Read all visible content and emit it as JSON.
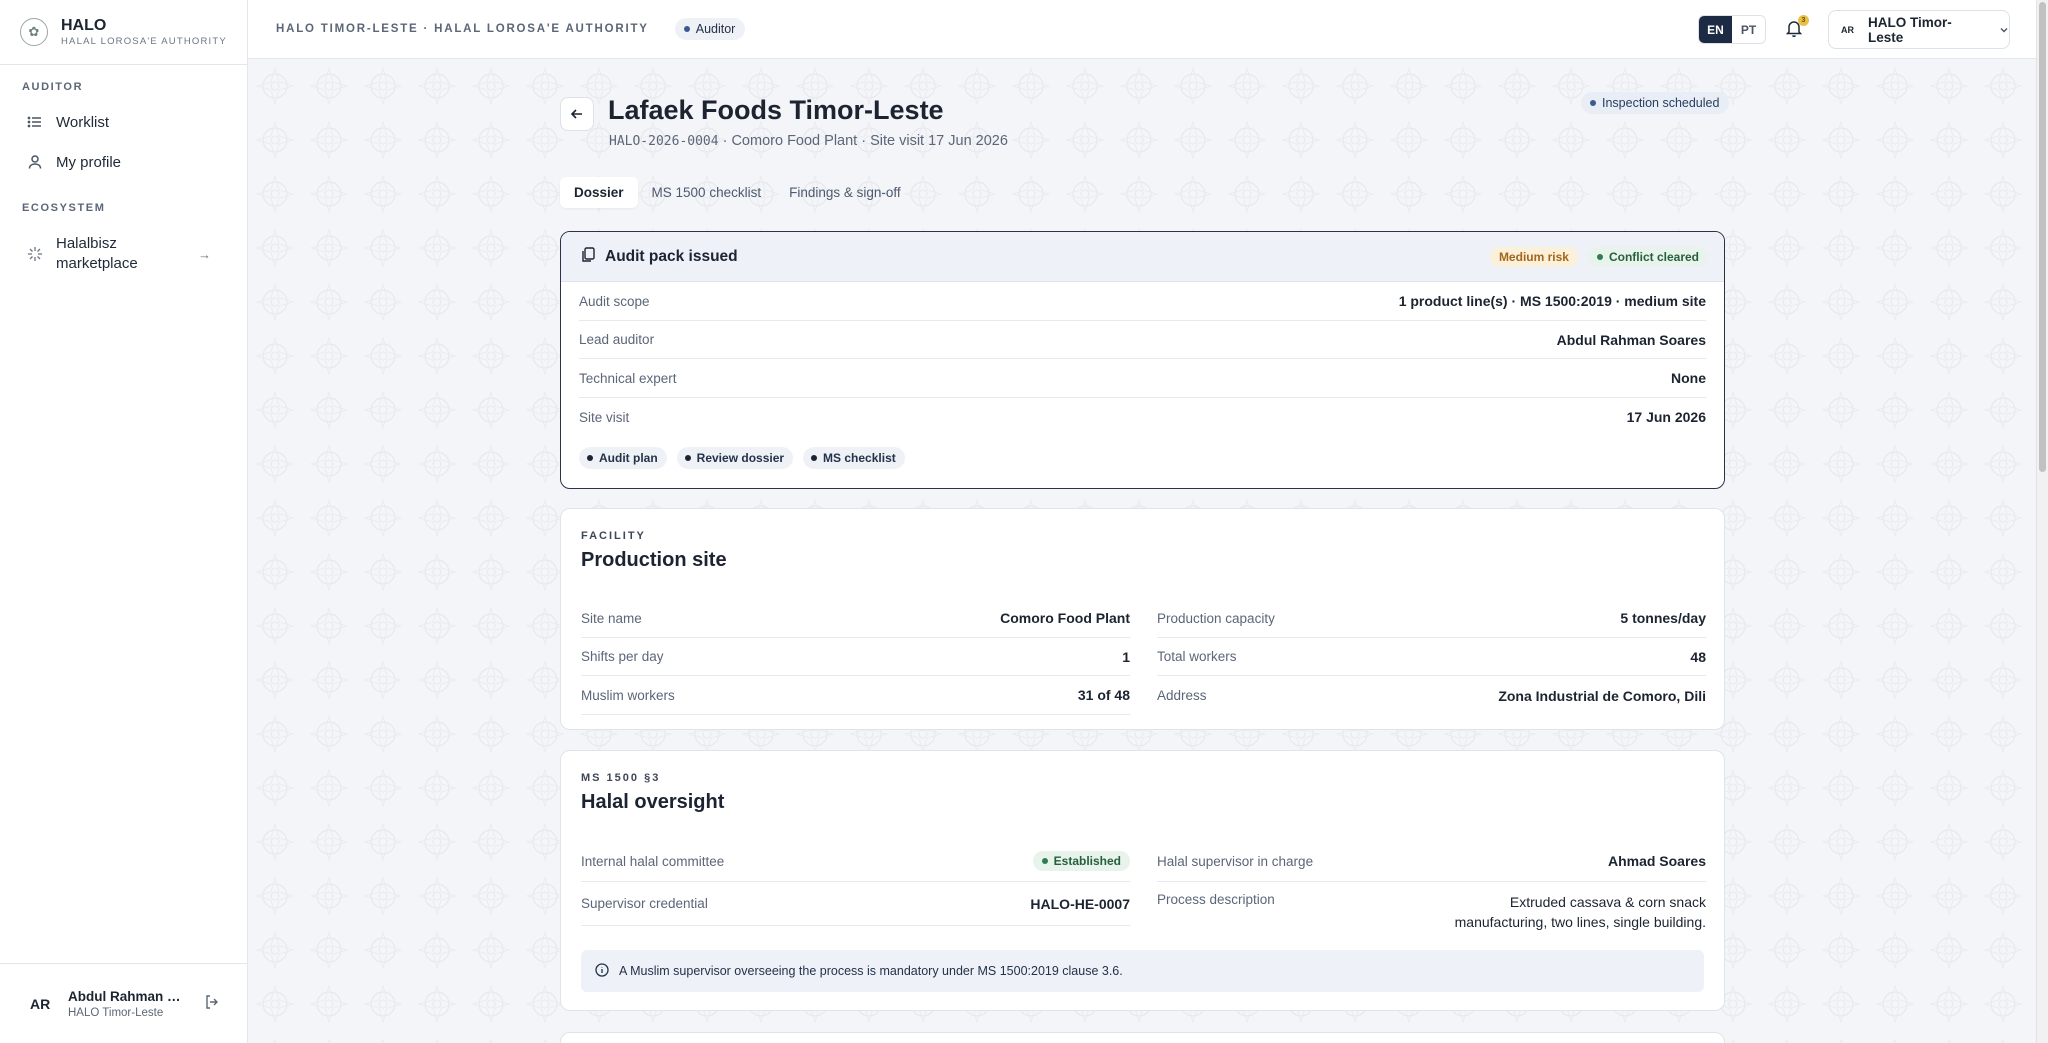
{
  "brand": {
    "title": "HALO",
    "subtitle": "HALAL LOROSA'E AUTHORITY"
  },
  "sidebar": {
    "sections": [
      {
        "label": "AUDITOR",
        "items": [
          {
            "label": "Worklist",
            "icon": "list-icon"
          },
          {
            "label": "My profile",
            "icon": "user-icon"
          }
        ]
      },
      {
        "label": "ECOSYSTEM",
        "items": [
          {
            "label": "Halalbisz marketplace",
            "icon": "sparkle-icon"
          }
        ]
      }
    ],
    "user": {
      "initials": "AR",
      "name": "Abdul Rahman Soares",
      "org": "HALO Timor-Leste"
    }
  },
  "topbar": {
    "org_label": "HALO TIMOR-LESTE · HALAL LOROSA'E AUTHORITY",
    "role": "Auditor",
    "languages": [
      "EN",
      "PT"
    ],
    "active_language": "EN",
    "notification_count": "3",
    "account": {
      "initials": "AR",
      "name": "HALO Timor-Leste"
    }
  },
  "page": {
    "title": "Lafaek Foods Timor-Leste",
    "ref_code": "HALO-2026-0004",
    "meta_rest": " · Comoro Food Plant · Site visit 17 Jun 2026",
    "status": "Inspection scheduled",
    "tabs": [
      "Dossier",
      "MS 1500 checklist",
      "Findings & sign-off"
    ],
    "active_tab": "Dossier"
  },
  "audit_pack": {
    "title": "Audit pack issued",
    "risk_badge": "Medium risk",
    "conflict_badge": "Conflict cleared",
    "rows": [
      {
        "label": "Audit scope",
        "value": "1 product line(s) · MS 1500:2019 · medium site"
      },
      {
        "label": "Lead auditor",
        "value": "Abdul Rahman Soares"
      },
      {
        "label": "Technical expert",
        "value": "None"
      },
      {
        "label": "Site visit",
        "value": "17 Jun 2026"
      }
    ],
    "actions": [
      "Audit plan",
      "Review dossier",
      "MS checklist"
    ]
  },
  "facility": {
    "kicker": "FACILITY",
    "title": "Production site",
    "left": [
      {
        "label": "Site name",
        "value": "Comoro Food Plant"
      },
      {
        "label": "Shifts per day",
        "value": "1"
      },
      {
        "label": "Muslim workers",
        "value": "31 of 48"
      }
    ],
    "right": [
      {
        "label": "Production capacity",
        "value": "5 tonnes/day"
      },
      {
        "label": "Total workers",
        "value": "48"
      },
      {
        "label": "Address",
        "value": "Zona Industrial de Comoro, Dili"
      }
    ]
  },
  "oversight": {
    "kicker": "MS 1500 §3",
    "title": "Halal oversight",
    "committee_label": "Internal halal committee",
    "committee_value": "Established",
    "credential_label": "Supervisor credential",
    "credential_value": "HALO-HE-0007",
    "supervisor_label": "Halal supervisor in charge",
    "supervisor_value": "Ahmad Soares",
    "process_label": "Process description",
    "process_value_line1": "Extruded cassava & corn snack",
    "process_value_line2": "manufacturing, two lines, single building.",
    "note": "A Muslim supervisor overseeing the process is mandatory under MS 1500:2019 clause 3.6."
  },
  "colors": {
    "accent": "#1c2a44",
    "success": "#2e7d4f",
    "warning": "#b7791f",
    "info": "#3b5b8f"
  }
}
